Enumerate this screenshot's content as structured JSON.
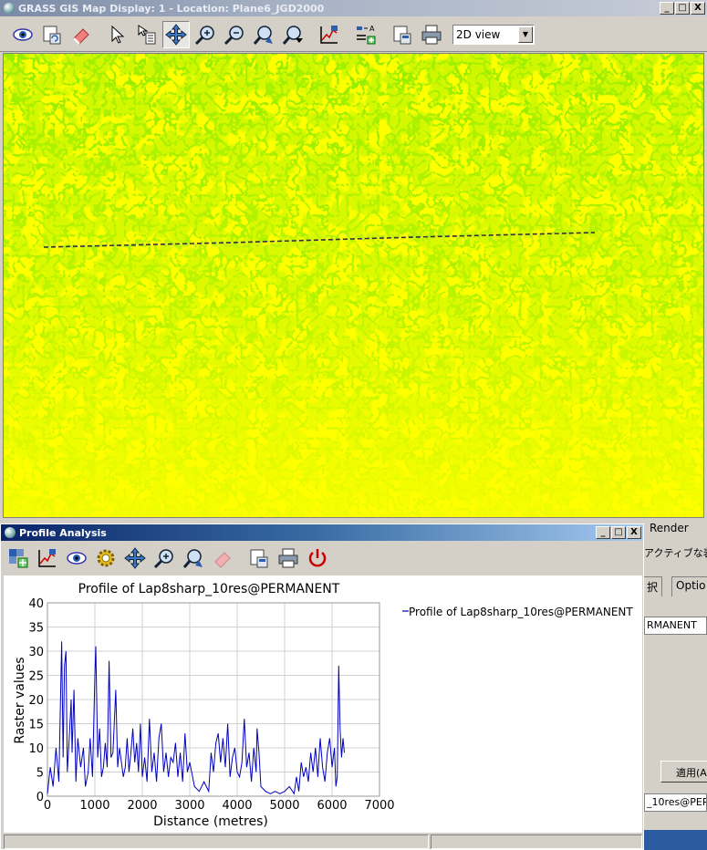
{
  "main_window": {
    "title": "GRASS GIS Map Display: 1 - Location: Plane6_JGD2000",
    "buttons": {
      "minimize": "_",
      "maximize": "□",
      "close": "X"
    }
  },
  "main_toolbar": {
    "tools": [
      {
        "icon": "display-map-icon"
      },
      {
        "icon": "render-map-icon"
      },
      {
        "icon": "erase-display-icon"
      },
      {
        "icon": "pointer-icon"
      },
      {
        "icon": "query-icon"
      },
      {
        "icon": "pan-icon",
        "active": true
      },
      {
        "icon": "zoom-in-icon"
      },
      {
        "icon": "zoom-out-icon"
      },
      {
        "icon": "zoom-back-icon"
      },
      {
        "icon": "zoom-menu-icon"
      },
      {
        "icon": "analyze-icon"
      },
      {
        "icon": "decoration-icon"
      },
      {
        "icon": "save-icon"
      },
      {
        "icon": "print-icon"
      }
    ],
    "view_mode": "2D view"
  },
  "map": {
    "background_color": "#ffff00",
    "feature_color": "#66e000",
    "profile_line_color": "#333333"
  },
  "side_panel": {
    "render_label": "Render",
    "active_label": "アクティブな表",
    "tab_left": "択",
    "tab_right": "Optio",
    "mapset_field": "RMANENT",
    "apply_button": "適用(A",
    "layer_field": "_10res@PERM"
  },
  "profile_window": {
    "title": "Profile Analysis",
    "buttons": {
      "minimize": "_",
      "maximize": "□",
      "close": "X"
    },
    "tools": [
      {
        "icon": "add-raster-icon"
      },
      {
        "icon": "draw-profile-icon"
      },
      {
        "icon": "display-icon"
      },
      {
        "icon": "settings-icon"
      },
      {
        "icon": "pan-icon"
      },
      {
        "icon": "zoom-icon"
      },
      {
        "icon": "zoom-back-icon"
      },
      {
        "icon": "erase-icon"
      },
      {
        "icon": "save-icon"
      },
      {
        "icon": "print-icon"
      },
      {
        "icon": "quit-icon"
      }
    ]
  },
  "chart_data": {
    "type": "line",
    "title": "Profile of Lap8sharp_10res@PERMANENT",
    "xlabel": "Distance (metres)",
    "ylabel": "Raster values",
    "xlim": [
      0,
      7000
    ],
    "ylim": [
      0,
      40
    ],
    "xticks": [
      "0",
      "1000",
      "2000",
      "3000",
      "4000",
      "5000",
      "6000",
      "7000"
    ],
    "yticks": [
      "0",
      "5",
      "10",
      "15",
      "20",
      "25",
      "30",
      "35",
      "40"
    ],
    "grid": true,
    "legend_position": "right",
    "series": [
      {
        "name": "Profile of Lap8sharp_10res@PERMANENT",
        "color": "#0000c0",
        "x": [
          0,
          60,
          120,
          180,
          240,
          260,
          300,
          330,
          360,
          390,
          420,
          460,
          500,
          520,
          560,
          600,
          640,
          700,
          760,
          800,
          860,
          900,
          950,
          1000,
          1020,
          1060,
          1100,
          1140,
          1180,
          1220,
          1260,
          1300,
          1340,
          1380,
          1440,
          1480,
          1520,
          1560,
          1600,
          1640,
          1680,
          1720,
          1760,
          1800,
          1840,
          1880,
          1920,
          1960,
          2000,
          2050,
          2100,
          2150,
          2200,
          2250,
          2300,
          2350,
          2400,
          2450,
          2500,
          2550,
          2600,
          2650,
          2700,
          2750,
          2800,
          2850,
          2900,
          2950,
          3000,
          3100,
          3200,
          3300,
          3400,
          3450,
          3500,
          3550,
          3600,
          3650,
          3700,
          3750,
          3800,
          3850,
          3900,
          3950,
          4000,
          4050,
          4100,
          4150,
          4200,
          4250,
          4300,
          4350,
          4400,
          4420,
          4460,
          4500,
          4600,
          4700,
          4800,
          4900,
          5000,
          5100,
          5200,
          5250,
          5300,
          5350,
          5400,
          5450,
          5500,
          5550,
          5600,
          5650,
          5700,
          5750,
          5800,
          5850,
          5900,
          5950,
          6000,
          6050,
          6080,
          6110,
          6140,
          6170,
          6200,
          6230,
          6260
        ],
        "y": [
          0.5,
          6,
          2,
          10,
          3,
          12,
          32,
          8,
          27,
          30,
          5,
          12,
          20,
          9,
          22,
          3,
          12,
          6,
          10,
          2,
          5,
          12,
          4,
          25,
          31,
          8,
          14,
          4,
          6,
          11,
          6,
          28,
          8,
          9,
          22,
          6,
          10,
          7,
          4,
          6,
          12,
          5,
          9,
          14,
          7,
          11,
          5,
          15,
          4,
          8,
          3,
          16,
          5,
          9,
          3,
          12,
          15,
          5,
          9,
          4,
          8,
          7,
          11,
          4,
          9,
          3,
          13,
          5,
          7,
          2,
          1,
          3,
          1,
          9,
          5,
          11,
          13,
          7,
          12,
          6,
          15,
          4,
          8,
          10,
          5,
          4,
          7,
          16,
          6,
          9,
          3,
          10,
          5,
          14,
          9,
          2,
          1,
          0.5,
          1,
          0.5,
          1,
          2,
          0.5,
          4,
          1,
          7,
          4,
          6,
          3,
          9,
          5,
          10,
          4,
          12,
          6,
          3,
          9,
          12,
          6,
          10,
          2,
          4,
          27,
          14,
          8,
          12,
          9
        ]
      }
    ]
  }
}
